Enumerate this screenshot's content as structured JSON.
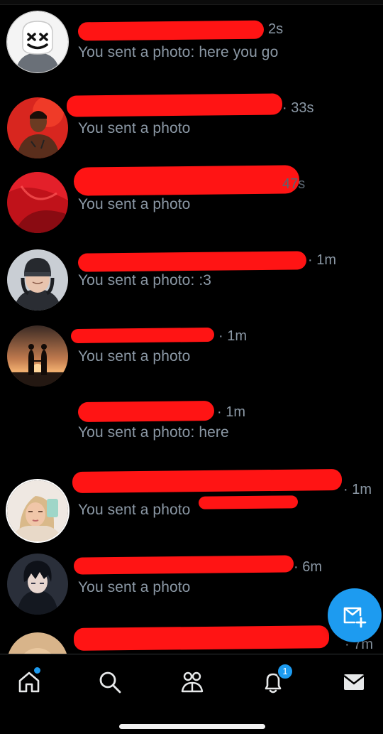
{
  "conversations": [
    {
      "time": "2s",
      "preview": "You sent a photo: here you go",
      "avatar": "marshmello-helmet"
    },
    {
      "time": "· 33s",
      "preview": "You sent a photo",
      "avatar": "red-concert-portrait"
    },
    {
      "time": "47s",
      "preview": "You sent a photo",
      "avatar": "red-abstract"
    },
    {
      "time": "· 1m",
      "preview": "You sent a photo: :3",
      "avatar": "beanie-headset-person"
    },
    {
      "time": "· 1m",
      "preview": "You sent a photo",
      "avatar": "sunset-couple-silhouette"
    },
    {
      "time": "· 1m",
      "preview": "You sent a photo: here",
      "avatar": "none"
    },
    {
      "time": "· 1m",
      "preview": "You sent a photo",
      "avatar": "blonde-selfie"
    },
    {
      "time": "· 6m",
      "preview": "You sent a photo",
      "avatar": "dark-anime-character"
    },
    {
      "time": "· 7m",
      "preview": "",
      "avatar": "partial-face"
    }
  ],
  "fab": {
    "icon": "new-message-icon"
  },
  "tabs": [
    {
      "name": "home",
      "icon": "home-icon",
      "indicator": true
    },
    {
      "name": "search",
      "icon": "search-icon"
    },
    {
      "name": "communities",
      "icon": "communities-icon"
    },
    {
      "name": "notifications",
      "icon": "bell-icon",
      "badge": "1"
    },
    {
      "name": "messages",
      "icon": "envelope-icon",
      "active": true
    }
  ],
  "colors": {
    "accent": "#1d9bf0",
    "redaction": "#ff1414",
    "secondary_text": "#8b98a5"
  }
}
